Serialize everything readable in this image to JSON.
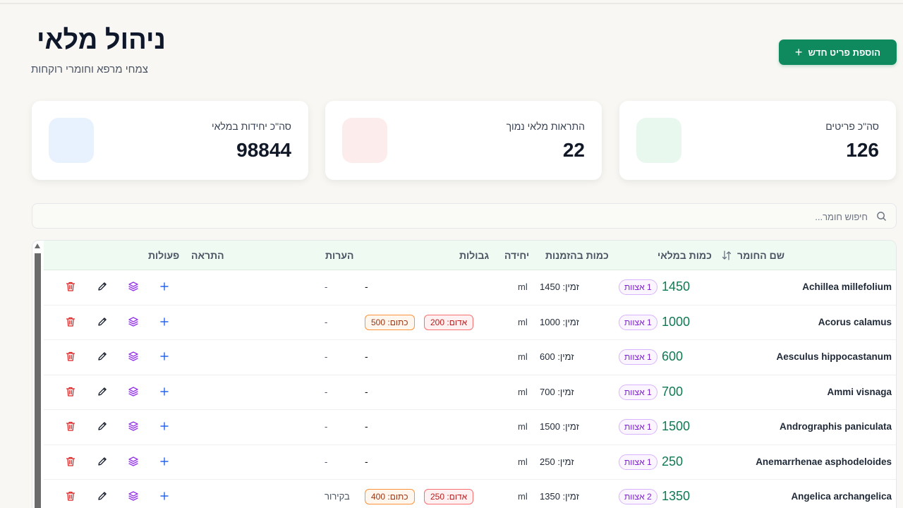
{
  "header": {
    "title": "ניהול מלאי",
    "subtitle": "צמחי מרפא וחומרי רוקחות",
    "add_button": "הוספת פריט חדש"
  },
  "stats": [
    {
      "label": "סה\"כ פריטים",
      "value": "126",
      "color": "#e8f8ef"
    },
    {
      "label": "התראות מלאי נמוך",
      "value": "22",
      "color": "#fdecec"
    },
    {
      "label": "סה\"כ יחידות במלאי",
      "value": "98844",
      "color": "#e8f1fe"
    }
  ],
  "search": {
    "placeholder": "חיפוש חומר..."
  },
  "table": {
    "headers": {
      "name": "שם החומר",
      "stock": "כמות במלאי",
      "order": "כמות בהזמנות",
      "unit": "יחידה",
      "limits": "גבולות",
      "notes": "הערות",
      "alert": "התראה",
      "actions": "פעולות"
    },
    "rows": [
      {
        "name": "Achillea millefolium",
        "qty": "1450",
        "batches": "1 אצוות",
        "order": "זמין: 1450",
        "unit": "ml",
        "red": "",
        "orange": "",
        "limits": "-",
        "notes": "-"
      },
      {
        "name": "Acorus calamus",
        "qty": "1000",
        "batches": "1 אצוות",
        "order": "זמין: 1000",
        "unit": "ml",
        "red": "אדום: 200",
        "orange": "כתום: 500",
        "limits": "",
        "notes": "-"
      },
      {
        "name": "Aesculus hippocastanum",
        "qty": "600",
        "batches": "1 אצוות",
        "order": "זמין: 600",
        "unit": "ml",
        "red": "",
        "orange": "",
        "limits": "-",
        "notes": "-"
      },
      {
        "name": "Ammi visnaga",
        "qty": "700",
        "batches": "1 אצוות",
        "order": "זמין: 700",
        "unit": "ml",
        "red": "",
        "orange": "",
        "limits": "-",
        "notes": "-"
      },
      {
        "name": "Andrographis paniculata",
        "qty": "1500",
        "batches": "1 אצוות",
        "order": "זמין: 1500",
        "unit": "ml",
        "red": "",
        "orange": "",
        "limits": "-",
        "notes": "-"
      },
      {
        "name": "Anemarrhenae asphodeloides",
        "qty": "250",
        "batches": "1 אצוות",
        "order": "זמין: 250",
        "unit": "ml",
        "red": "",
        "orange": "",
        "limits": "-",
        "notes": "-"
      },
      {
        "name": "Angelica archangelica",
        "qty": "1350",
        "batches": "2 אצוות",
        "order": "זמין: 1350",
        "unit": "ml",
        "red": "אדום: 250",
        "orange": "כתום: 400",
        "limits": "",
        "notes": "בקירור"
      }
    ]
  },
  "colors": {
    "accent": "#0f8a5f",
    "qty": "#0f7a52",
    "batch": "#7e22ce",
    "delete": "#dc2626",
    "layers": "#9333ea",
    "add": "#2563eb"
  }
}
